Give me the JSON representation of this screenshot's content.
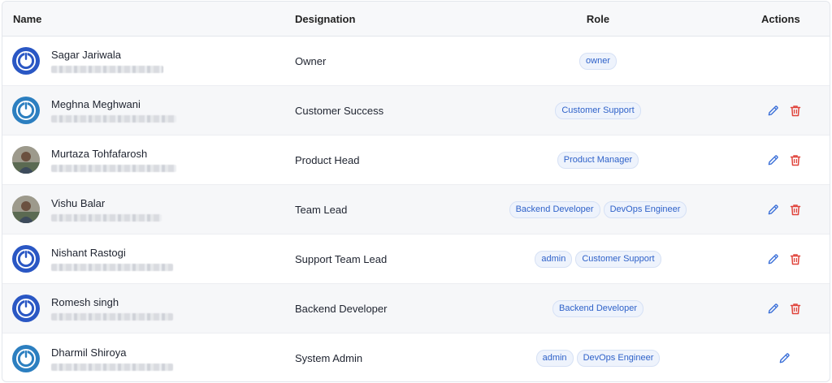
{
  "table": {
    "headers": {
      "name": "Name",
      "designation": "Designation",
      "role": "Role",
      "actions": "Actions"
    },
    "rows": [
      {
        "name": "Sagar Jariwala",
        "designation": "Owner",
        "roles": [
          "owner"
        ],
        "avatar": "logo",
        "can_edit": false,
        "can_delete": false
      },
      {
        "name": "Meghna Meghwani",
        "designation": "Customer Success",
        "roles": [
          "Customer Support"
        ],
        "avatar": "logo-teal",
        "can_edit": true,
        "can_delete": true
      },
      {
        "name": "Murtaza Tohfafarosh",
        "designation": "Product Head",
        "roles": [
          "Product Manager"
        ],
        "avatar": "photo",
        "can_edit": true,
        "can_delete": true
      },
      {
        "name": "Vishu Balar",
        "designation": "Team Lead",
        "roles": [
          "Backend Developer",
          "DevOps Engineer"
        ],
        "avatar": "photo",
        "can_edit": true,
        "can_delete": true
      },
      {
        "name": "Nishant Rastogi",
        "designation": "Support Team Lead",
        "roles": [
          "admin",
          "Customer Support"
        ],
        "avatar": "logo",
        "can_edit": true,
        "can_delete": true
      },
      {
        "name": "Romesh singh",
        "designation": "Backend Developer",
        "roles": [
          "Backend Developer"
        ],
        "avatar": "logo",
        "can_edit": true,
        "can_delete": true
      },
      {
        "name": "Dharmil Shiroya",
        "designation": "System Admin",
        "roles": [
          "admin",
          "DevOps Engineer"
        ],
        "avatar": "logo-teal",
        "can_edit": true,
        "can_delete": false
      }
    ]
  },
  "icons": {
    "edit": "pencil-icon",
    "delete": "trash-icon"
  },
  "colors": {
    "tag_text": "#2f62c9",
    "tag_bg": "#eef3fc",
    "edit": "#3a6fd8",
    "delete": "#e0443c",
    "avatar_blue": "#2a57c4"
  }
}
